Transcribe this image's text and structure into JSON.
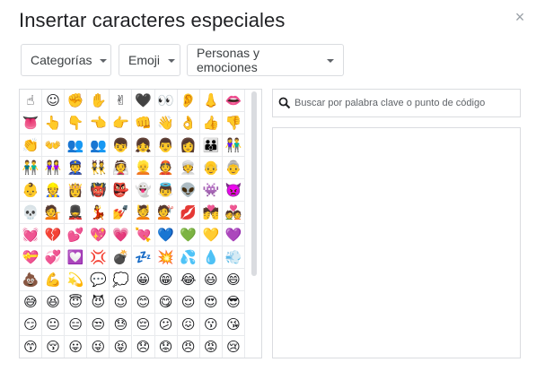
{
  "dialog": {
    "title": "Insertar caracteres especiales",
    "close_glyph": "×"
  },
  "filters": {
    "category": "Categorías",
    "type": "Emoji",
    "subtype": "Personas y emociones"
  },
  "search": {
    "placeholder": "Buscar por palabra clave o punto de código",
    "value": ""
  },
  "grid": {
    "rows": [
      [
        "☝",
        "☺",
        "✊",
        "✋",
        "✌",
        "🖤",
        "👀",
        "👂",
        "👃",
        "👄"
      ],
      [
        "👅",
        "👆",
        "👇",
        "👈",
        "👉",
        "👊",
        "👋",
        "👌",
        "👍",
        "👎"
      ],
      [
        "👏",
        "👐",
        "👥",
        "👥",
        "👦",
        "👧",
        "👨",
        "👩",
        "👪",
        "👫"
      ],
      [
        "👬",
        "👭",
        "👮",
        "👯",
        "👰",
        "👱",
        "👲",
        "👳",
        "👴",
        "👵"
      ],
      [
        "👶",
        "👷",
        "👸",
        "👹",
        "👺",
        "👻",
        "👼",
        "👽",
        "👾",
        "👿"
      ],
      [
        "💀",
        "💁",
        "💂",
        "💃",
        "💅",
        "💆",
        "💇",
        "💋",
        "💏",
        "💑"
      ],
      [
        "💓",
        "💔",
        "💕",
        "💖",
        "💗",
        "💘",
        "💙",
        "💚",
        "💛",
        "💜"
      ],
      [
        "💝",
        "💞",
        "💟",
        "💢",
        "💣",
        "💤",
        "💥",
        "💦",
        "💧",
        "💨"
      ],
      [
        "💩",
        "💪",
        "💫",
        "💬",
        "💭",
        "😀",
        "😁",
        "😂",
        "😃",
        "😄"
      ],
      [
        "😅",
        "😆",
        "😇",
        "😈",
        "😉",
        "😊",
        "😋",
        "😌",
        "😍",
        "😎"
      ],
      [
        "😏",
        "😐",
        "😑",
        "😒",
        "😓",
        "😔",
        "😕",
        "😖",
        "😗",
        "😘"
      ],
      [
        "😙",
        "😚",
        "😛",
        "😜",
        "😝",
        "😞",
        "😟",
        "😠",
        "😡",
        "😢"
      ]
    ]
  },
  "colors": {
    "border": "#dadce0",
    "text": "#202124",
    "muted": "#5f6368"
  }
}
